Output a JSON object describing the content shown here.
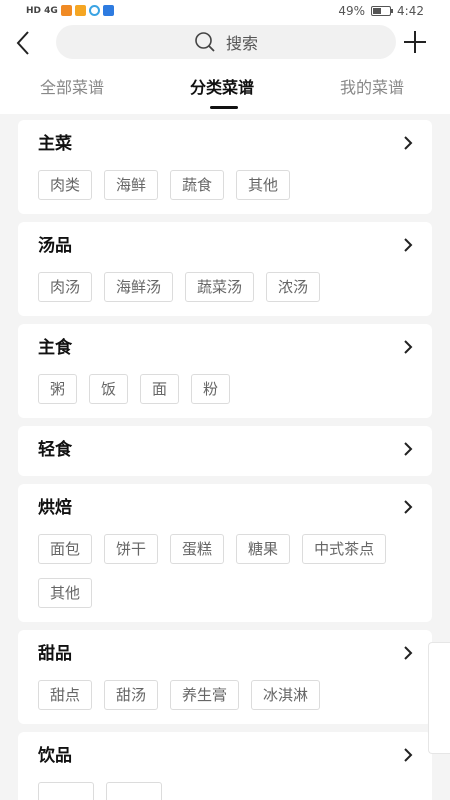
{
  "status": {
    "left_text": "HD 4G",
    "battery": "49%",
    "battery_level": 0.49,
    "time": "4:42"
  },
  "search": {
    "placeholder": "搜索"
  },
  "tabs": [
    {
      "label": "全部菜谱"
    },
    {
      "label": "分类菜谱",
      "active": true
    },
    {
      "label": "我的菜谱"
    }
  ],
  "categories": [
    {
      "title": "主菜",
      "items": [
        "肉类",
        "海鲜",
        "蔬食",
        "其他"
      ]
    },
    {
      "title": "汤品",
      "items": [
        "肉汤",
        "海鲜汤",
        "蔬菜汤",
        "浓汤"
      ]
    },
    {
      "title": "主食",
      "items": [
        "粥",
        "饭",
        "面",
        "粉"
      ]
    },
    {
      "title": "轻食",
      "items": []
    },
    {
      "title": "烘焙",
      "items": [
        "面包",
        "饼干",
        "蛋糕",
        "糖果",
        "中式茶点",
        "其他"
      ]
    },
    {
      "title": "甜品",
      "items": [
        "甜点",
        "甜汤",
        "养生膏",
        "冰淇淋"
      ]
    },
    {
      "title": "饮品",
      "items": [
        "",
        ""
      ]
    }
  ],
  "colors": {
    "background": "#f4f4f4",
    "card": "#ffffff",
    "chip_border": "#dcdcdc",
    "active_tab": "#111111"
  }
}
